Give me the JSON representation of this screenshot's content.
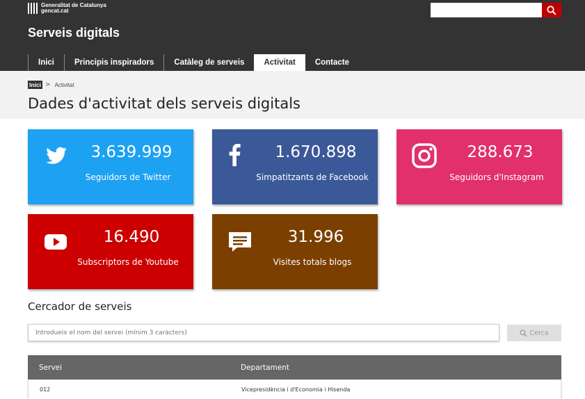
{
  "header": {
    "logo_line1": "Generalitat de Catalunya",
    "logo_line2": "gencat.cat",
    "site_title": "Serveis digitals",
    "search": {
      "value": "",
      "icon": "search-icon"
    }
  },
  "nav": [
    {
      "label": "Inici",
      "active": false
    },
    {
      "label": "Principis inspiradors",
      "active": false
    },
    {
      "label": "Catàleg de serveis",
      "active": false
    },
    {
      "label": "Activitat",
      "active": true
    },
    {
      "label": "Contacte",
      "active": false
    }
  ],
  "breadcrumb": {
    "home": "Inici",
    "separator": ">",
    "current": "Activitat"
  },
  "page_title": "Dades d'activitat dels serveis digitals",
  "stats": [
    {
      "value": "3.639.999",
      "label": "Seguidors de Twitter",
      "icon": "twitter-icon",
      "color": "#1da1f2"
    },
    {
      "value": "1.670.898",
      "label": "Simpatitzants de Facebook",
      "icon": "facebook-icon",
      "color": "#3b5998"
    },
    {
      "value": "288.673",
      "label": "Seguidors d'Instagram",
      "icon": "instagram-icon",
      "color": "#e1306c"
    },
    {
      "value": "16.490",
      "label": "Subscriptors de Youtube",
      "icon": "youtube-icon",
      "color": "#cc0000"
    },
    {
      "value": "31.996",
      "label": "Visites totals blogs",
      "icon": "chat-icon",
      "color": "#7b3f00"
    }
  ],
  "service_search": {
    "title": "Cercador de serveis",
    "placeholder": "Introdueix el nom del servei (mínim 3 caràcters)",
    "button_label": "Cerca"
  },
  "table": {
    "headers": [
      "Servei",
      "Departament"
    ],
    "rows": [
      [
        "012",
        "Vicepresidència i d'Economia i Hisenda"
      ]
    ]
  },
  "colors": {
    "header_bg": "#333333",
    "search_red": "#c00000",
    "table_header": "#666666"
  }
}
